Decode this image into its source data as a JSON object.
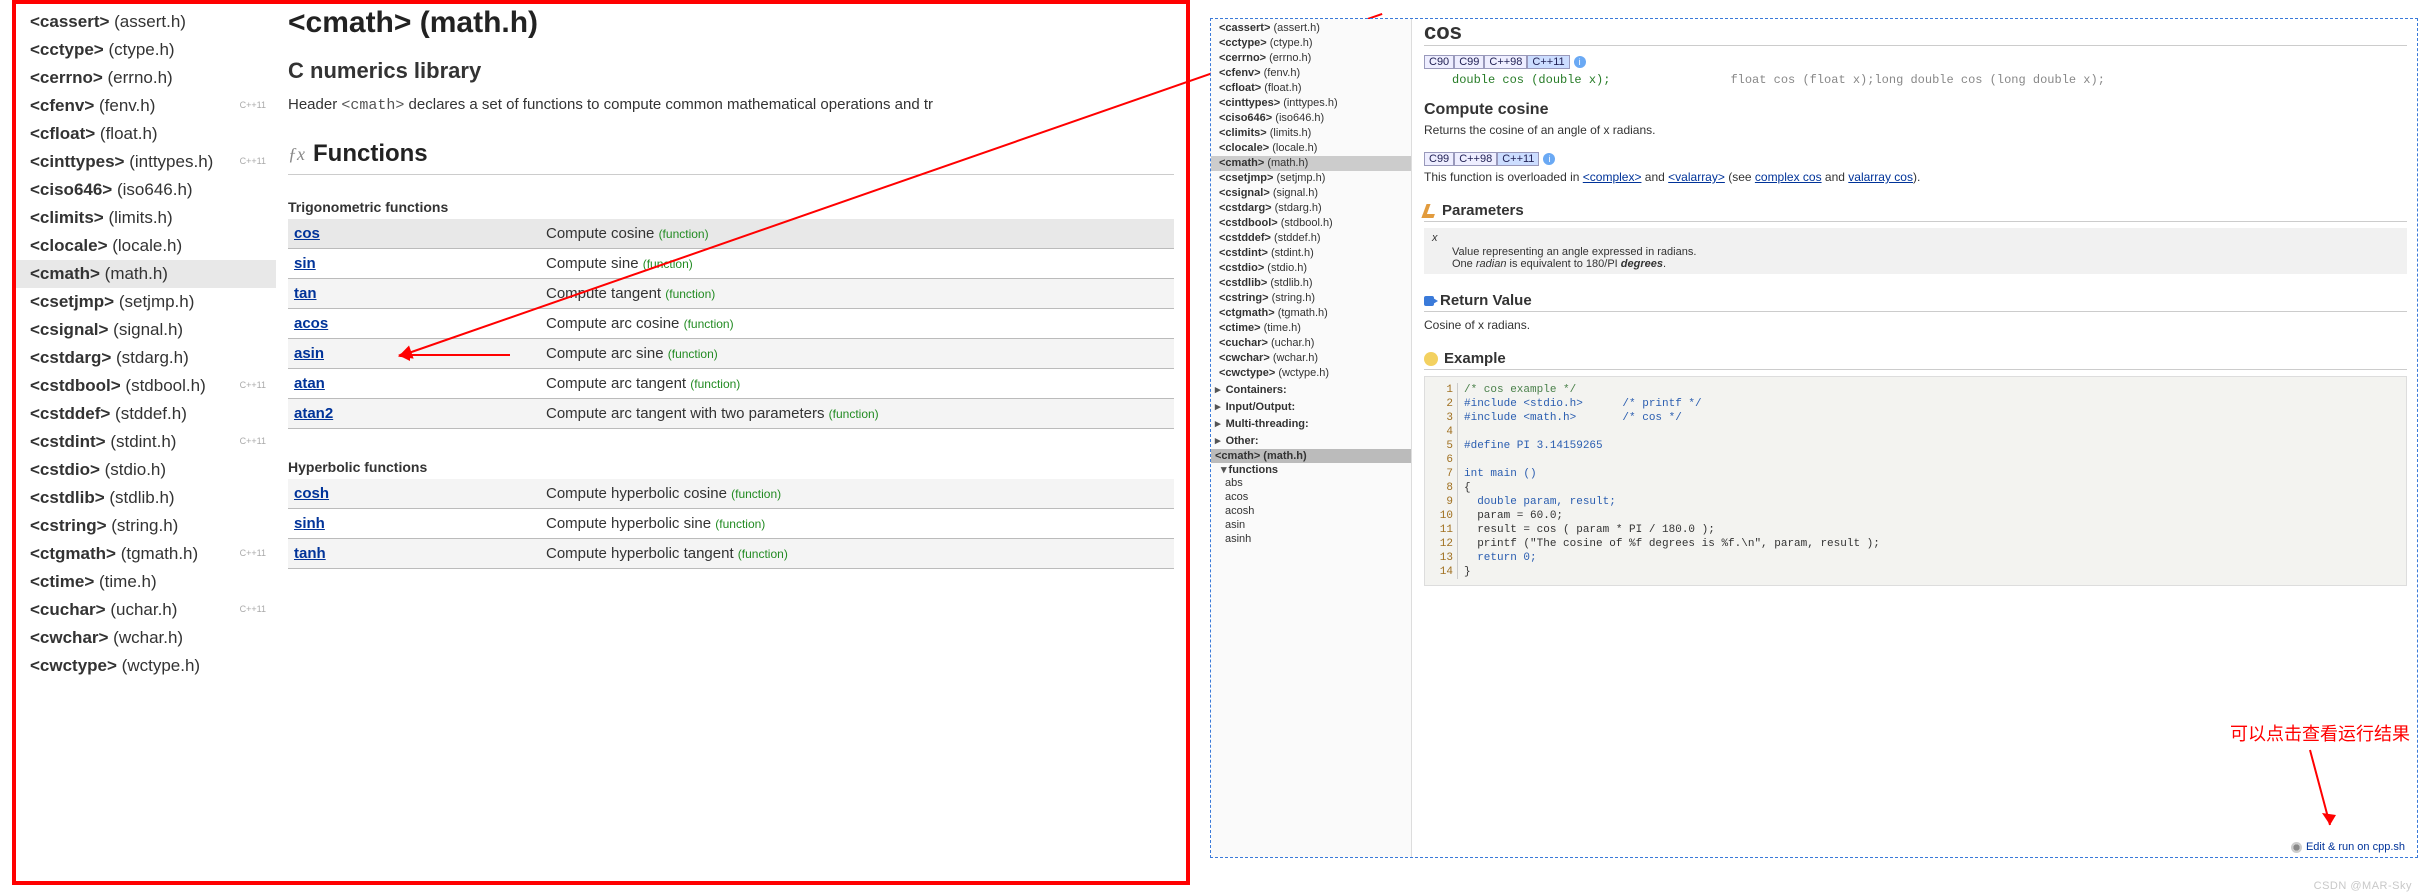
{
  "left": {
    "sidebar": {
      "items": [
        {
          "n": "<cassert>",
          "s": "(assert.h)",
          "std": ""
        },
        {
          "n": "<cctype>",
          "s": "(ctype.h)",
          "std": ""
        },
        {
          "n": "<cerrno>",
          "s": "(errno.h)",
          "std": ""
        },
        {
          "n": "<cfenv>",
          "s": "(fenv.h)",
          "std": "C++11"
        },
        {
          "n": "<cfloat>",
          "s": "(float.h)",
          "std": ""
        },
        {
          "n": "<cinttypes>",
          "s": "(inttypes.h)",
          "std": "C++11"
        },
        {
          "n": "<ciso646>",
          "s": "(iso646.h)",
          "std": ""
        },
        {
          "n": "<climits>",
          "s": "(limits.h)",
          "std": ""
        },
        {
          "n": "<clocale>",
          "s": "(locale.h)",
          "std": ""
        },
        {
          "n": "<cmath>",
          "s": "(math.h)",
          "std": "",
          "sel": true
        },
        {
          "n": "<csetjmp>",
          "s": "(setjmp.h)",
          "std": ""
        },
        {
          "n": "<csignal>",
          "s": "(signal.h)",
          "std": ""
        },
        {
          "n": "<cstdarg>",
          "s": "(stdarg.h)",
          "std": ""
        },
        {
          "n": "<cstdbool>",
          "s": "(stdbool.h)",
          "std": "C++11"
        },
        {
          "n": "<cstddef>",
          "s": "(stddef.h)",
          "std": ""
        },
        {
          "n": "<cstdint>",
          "s": "(stdint.h)",
          "std": "C++11"
        },
        {
          "n": "<cstdio>",
          "s": "(stdio.h)",
          "std": ""
        },
        {
          "n": "<cstdlib>",
          "s": "(stdlib.h)",
          "std": ""
        },
        {
          "n": "<cstring>",
          "s": "(string.h)",
          "std": ""
        },
        {
          "n": "<ctgmath>",
          "s": "(tgmath.h)",
          "std": "C++11"
        },
        {
          "n": "<ctime>",
          "s": "(time.h)",
          "std": ""
        },
        {
          "n": "<cuchar>",
          "s": "(uchar.h)",
          "std": "C++11"
        },
        {
          "n": "<cwchar>",
          "s": "(wchar.h)",
          "std": ""
        },
        {
          "n": "<cwctype>",
          "s": "(wctype.h)",
          "std": ""
        }
      ]
    },
    "title": "<cmath> (math.h)",
    "subheading": "C numerics library",
    "desc_pre": "Header ",
    "desc_code": "<cmath>",
    "desc_post": " declares a set of functions to compute common mathematical operations and tr",
    "sect_title": "Functions",
    "trig_label": "Trigonometric functions",
    "trig": [
      {
        "fn": "cos",
        "desc": "Compute cosine",
        "hl": true
      },
      {
        "fn": "sin",
        "desc": "Compute sine"
      },
      {
        "fn": "tan",
        "desc": "Compute tangent"
      },
      {
        "fn": "acos",
        "desc": "Compute arc cosine"
      },
      {
        "fn": "asin",
        "desc": "Compute arc sine"
      },
      {
        "fn": "atan",
        "desc": "Compute arc tangent"
      },
      {
        "fn": "atan2",
        "desc": "Compute arc tangent with two parameters"
      }
    ],
    "hyp_label": "Hyperbolic functions",
    "hyp": [
      {
        "fn": "cosh",
        "desc": "Compute hyperbolic cosine"
      },
      {
        "fn": "sinh",
        "desc": "Compute hyperbolic sine"
      },
      {
        "fn": "tanh",
        "desc": "Compute hyperbolic tangent"
      }
    ],
    "fn_kind": "(function)"
  },
  "right": {
    "sidebar": {
      "items": [
        {
          "n": "<cassert>",
          "s": "(assert.h)"
        },
        {
          "n": "<cctype>",
          "s": "(ctype.h)"
        },
        {
          "n": "<cerrno>",
          "s": "(errno.h)"
        },
        {
          "n": "<cfenv>",
          "s": "(fenv.h)"
        },
        {
          "n": "<cfloat>",
          "s": "(float.h)"
        },
        {
          "n": "<cinttypes>",
          "s": "(inttypes.h)"
        },
        {
          "n": "<ciso646>",
          "s": "(iso646.h)"
        },
        {
          "n": "<climits>",
          "s": "(limits.h)"
        },
        {
          "n": "<clocale>",
          "s": "(locale.h)"
        },
        {
          "n": "<cmath>",
          "s": "(math.h)",
          "sel": true
        },
        {
          "n": "<csetjmp>",
          "s": "(setjmp.h)"
        },
        {
          "n": "<csignal>",
          "s": "(signal.h)"
        },
        {
          "n": "<cstdarg>",
          "s": "(stdarg.h)"
        },
        {
          "n": "<cstdbool>",
          "s": "(stdbool.h)"
        },
        {
          "n": "<cstddef>",
          "s": "(stddef.h)"
        },
        {
          "n": "<cstdint>",
          "s": "(stdint.h)"
        },
        {
          "n": "<cstdio>",
          "s": "(stdio.h)"
        },
        {
          "n": "<cstdlib>",
          "s": "(stdlib.h)"
        },
        {
          "n": "<cstring>",
          "s": "(string.h)"
        },
        {
          "n": "<ctgmath>",
          "s": "(tgmath.h)"
        },
        {
          "n": "<ctime>",
          "s": "(time.h)"
        },
        {
          "n": "<cuchar>",
          "s": "(uchar.h)"
        },
        {
          "n": "<cwchar>",
          "s": "(wchar.h)"
        },
        {
          "n": "<cwctype>",
          "s": "(wctype.h)"
        }
      ],
      "cats": [
        "Containers:",
        "Input/Output:",
        "Multi-threading:",
        "Other:"
      ],
      "sub_selected": "<cmath> (math.h)",
      "sub_label": "functions",
      "sub_items": [
        "abs",
        "acos",
        "acosh",
        "asin",
        "asinh"
      ]
    },
    "title": "cos",
    "std1": [
      "C90",
      "C99",
      "C++98",
      "C++11"
    ],
    "sig1": "double cos (double x);",
    "sig2": "float cos (float x);long double cos (long double x);",
    "compute_heading": "Compute cosine",
    "compute_desc": "Returns the cosine of an angle of x radians.",
    "std2": [
      "C99",
      "C++98",
      "C++11"
    ],
    "overload_pre": "This function is overloaded in ",
    "overload_l1": "<complex>",
    "overload_mid": " and ",
    "overload_l2": "<valarray>",
    "overload_see": " (see ",
    "overload_l3": "complex cos",
    "overload_and": " and ",
    "overload_l4": "valarray cos",
    "overload_end": ").",
    "params_heading": "Parameters",
    "param_x": "x",
    "param_desc1": "Value representing an angle expressed in radians.",
    "param_desc2": "One radian is equivalent to 180/PI degrees.",
    "return_heading": "Return Value",
    "return_desc": "Cosine of x radians.",
    "example_heading": "Example",
    "code": [
      {
        "ln": "1",
        "t": "/* cos example */",
        "cls": "codec-comment"
      },
      {
        "ln": "2",
        "t": "#include <stdio.h>      /* printf */",
        "cls": "codec-pre"
      },
      {
        "ln": "3",
        "t": "#include <math.h>       /* cos */",
        "cls": "codec-pre"
      },
      {
        "ln": "4",
        "t": ""
      },
      {
        "ln": "5",
        "t": "#define PI 3.14159265",
        "cls": "codec-pre"
      },
      {
        "ln": "6",
        "t": ""
      },
      {
        "ln": "7",
        "t": "int main ()",
        "cls": "codec-keyw"
      },
      {
        "ln": "8",
        "t": "{"
      },
      {
        "ln": "9",
        "t": "  double param, result;",
        "cls": "codec-keyw"
      },
      {
        "ln": "10",
        "t": "  param = 60.0;"
      },
      {
        "ln": "11",
        "t": "  result = cos ( param * PI / 180.0 );"
      },
      {
        "ln": "12",
        "t": "  printf (\"The cosine of %f degrees is %f.\\n\", param, result );"
      },
      {
        "ln": "13",
        "t": "  return 0;",
        "cls": "codec-keyw"
      },
      {
        "ln": "14",
        "t": "}"
      }
    ],
    "editrun": "Edit & run on cpp.sh"
  },
  "annotation": "可以点击查看运行结果",
  "watermark": "CSDN @MAR-Sky"
}
